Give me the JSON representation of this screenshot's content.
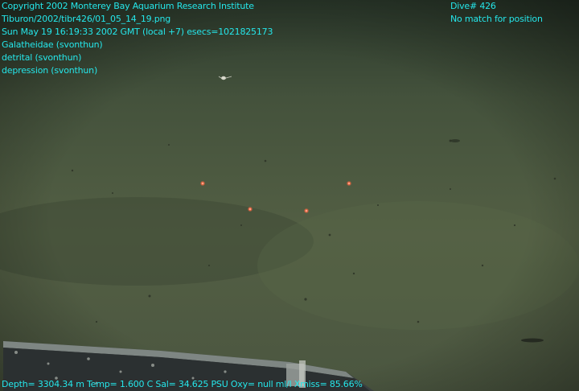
{
  "overlay": {
    "top_left": [
      "Copyright 2002 Monterey Bay Aquarium Research Institute",
      "Tiburon/2002/tibr426/01_05_14_19.png",
      "Sun May 19 16:19:33 2002 GMT (local +7)  esecs=1021825173",
      "Galatheidae (svonthun)",
      "detrital (svonthun)",
      "depression (svonthun)"
    ],
    "top_right": [
      "Dive# 426",
      "No match for position"
    ],
    "bottom": "Depth= 3304.34 m  Temp= 1.600 C  Sal= 34.625 PSU  Oxy= null ml/l  Xmiss= 85.66%"
  },
  "colors": {
    "overlay_text": "#25e6ea",
    "seafloor": "#4f5d43",
    "laser_dot": "#ff5a3a"
  }
}
